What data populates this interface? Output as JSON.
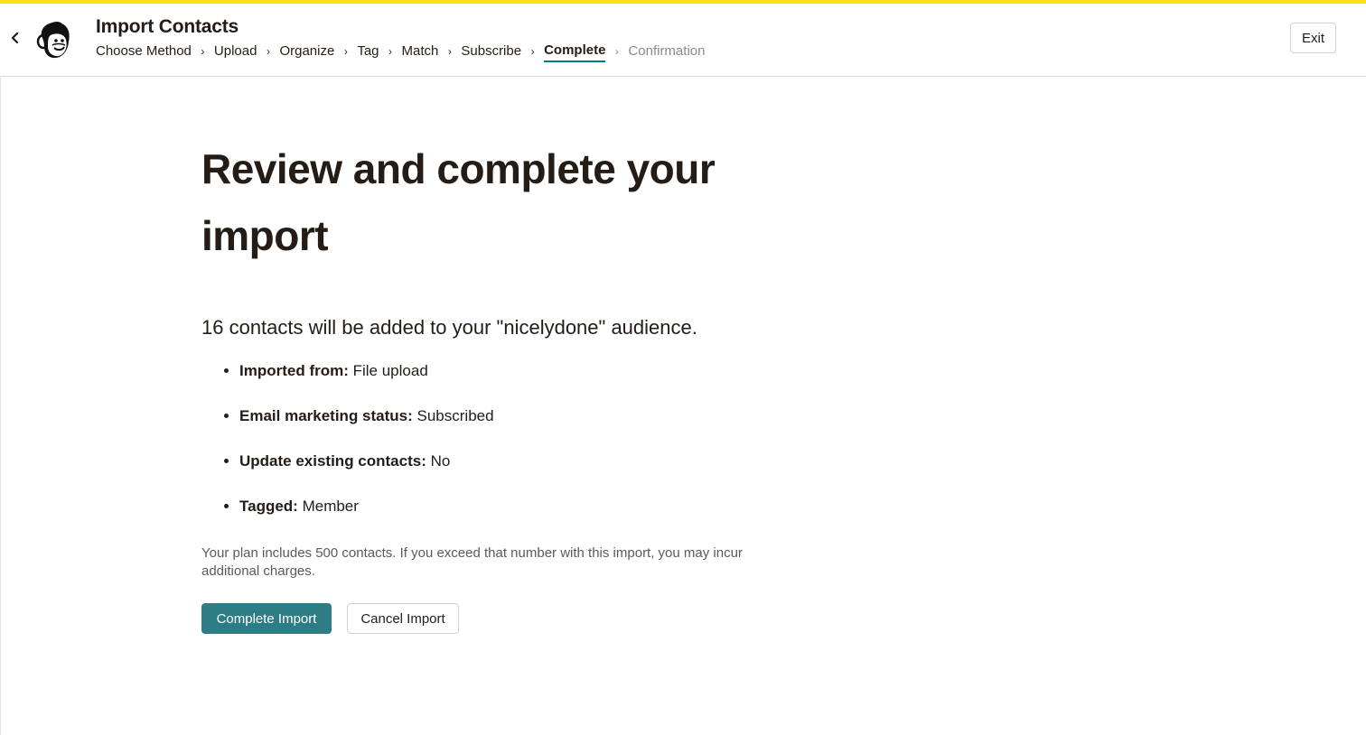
{
  "colors": {
    "accent_bar": "#ffe01b",
    "primary_button": "#2e7d86",
    "active_step_underline": "#007c89",
    "future_step": "#8a8a8a"
  },
  "header": {
    "back_icon": "chevron-left-icon",
    "logo_icon": "mailchimp-freddie-logo",
    "title": "Import Contacts",
    "steps": [
      {
        "label": "Choose Method",
        "state": "done"
      },
      {
        "label": "Upload",
        "state": "done"
      },
      {
        "label": "Organize",
        "state": "done"
      },
      {
        "label": "Tag",
        "state": "done"
      },
      {
        "label": "Match",
        "state": "done"
      },
      {
        "label": "Subscribe",
        "state": "done"
      },
      {
        "label": "Complete",
        "state": "current"
      },
      {
        "label": "Confirmation",
        "state": "future"
      }
    ],
    "exit_label": "Exit"
  },
  "main": {
    "heading": "Review and complete your import",
    "summary": "16 contacts will be added to your \"nicelydone\" audience.",
    "details": [
      {
        "label": "Imported from:",
        "value": "File upload"
      },
      {
        "label": "Email marketing status:",
        "value": "Subscribed"
      },
      {
        "label": "Update existing contacts:",
        "value": "No"
      },
      {
        "label": "Tagged:",
        "value": "Member"
      }
    ],
    "plan_note": "Your plan includes 500 contacts. If you exceed that number with this import, you may incur additional charges.",
    "complete_label": "Complete Import",
    "cancel_label": "Cancel Import"
  }
}
